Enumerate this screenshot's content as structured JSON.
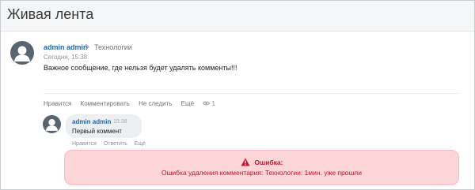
{
  "header": {
    "title": "Живая лента"
  },
  "post": {
    "author": "admin admin",
    "separator": ">",
    "group": "Технологии",
    "date": "Сегодня, 15:38",
    "text": "Важное сообщение, где нельзя будет удалять комменты!!!",
    "actions": {
      "like": "Нравится",
      "comment": "Комментировать",
      "unfollow": "Не следить",
      "more": "Ещё"
    },
    "views_icon": "eye-icon",
    "views_count": "1"
  },
  "comment": {
    "author": "admin admin",
    "time": "15:38",
    "text": "Первый коммент",
    "actions": {
      "like": "Нравится",
      "reply": "Ответить",
      "more": "Ещё"
    }
  },
  "error": {
    "icon": "warning-icon",
    "title": "Ошибка:",
    "message": "Ошибка удаления комментария: Технологии: 1мин. уже прошли",
    "colors": {
      "background": "#fbd5d8",
      "text": "#c4142a"
    }
  },
  "colors": {
    "link": "#2067b0",
    "avatar": "#5a6470"
  }
}
